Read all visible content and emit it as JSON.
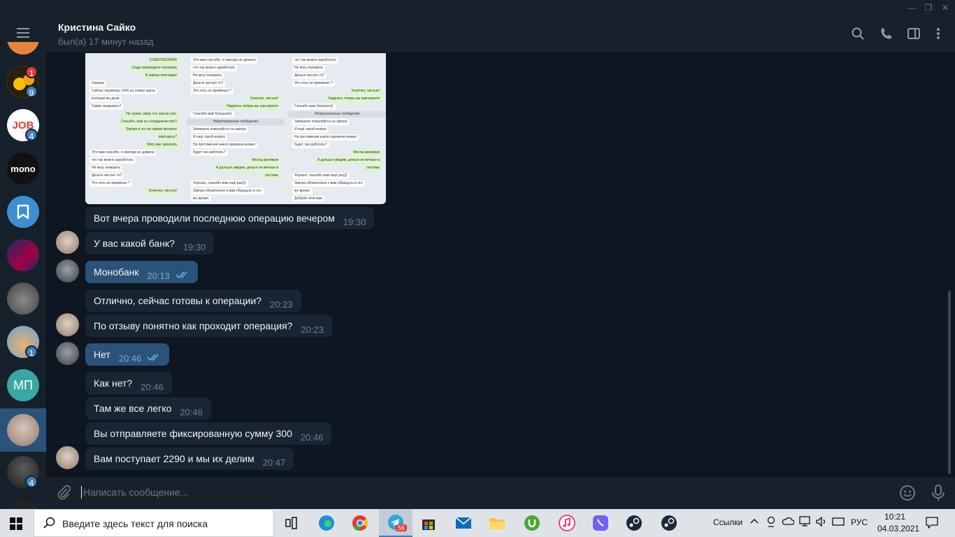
{
  "window": {
    "minimize": "—",
    "maximize": "❐",
    "close": "✕"
  },
  "sidebar": {
    "chats": [
      {
        "name": "chat-partial",
        "badge": ""
      },
      {
        "name": "chat-emoji",
        "badge": "9",
        "badge_top": "1"
      },
      {
        "name": "chat-job",
        "label": "JOB",
        "badge": "4"
      },
      {
        "name": "chat-mono",
        "label": "mono",
        "badge": ""
      },
      {
        "name": "chat-saved",
        "badge": ""
      },
      {
        "name": "chat-football",
        "badge": ""
      },
      {
        "name": "chat-cat",
        "badge": ""
      },
      {
        "name": "chat-cartoon",
        "badge": "1"
      },
      {
        "name": "chat-mp",
        "label": "МП",
        "badge": ""
      },
      {
        "name": "chat-kristina",
        "badge": ""
      },
      {
        "name": "chat-man",
        "badge": "4"
      }
    ]
  },
  "header": {
    "name": "Кристина Сайко",
    "status": "был(а) 17 минут назад"
  },
  "photo": {
    "col1": [
      "51689765234500",
      "Сюда переводите половину",
      "И завтра повторим!",
      "Хорошо",
      "Сейчас перевожу 1045 на номер карты",
      "который вы дали",
      "Скрин скидывать?",
      "Не нужно, вижу что зашли уже.",
      "Спасибо, вам за сотрудничество!!!",
      "Завтра в это же время желаете",
      "повторить?",
      "Могу вас записать",
      "Это вам спасибо, я никогда не думала",
      "что так можно заработать",
      "Не могу поверить",
      "Деньги чистые то?",
      "Это хоть не криминал ?",
      "Конечно, чистые!"
    ],
    "col2": [
      "Это вам спасибо, я никогда не думала",
      "что так можно заработать",
      "Не могу поверить",
      "Деньги чистые то?",
      "Это хоть не криминал ?",
      "Конечно, чистые!",
      "Надеюсь теперь вы нам верите",
      "Спасибо вам большое))",
      "Непрочитанные сообщения",
      "Запишите пожалуйста на завтра",
      "И ещё такой вопрос",
      "На протяжении какого времени можно",
      "будет так работать?",
      "Месяц минимум",
      "А дальше увидим, деньги не вечные в",
      "системе",
      "Хорошо, спасибо вам ещё раз)))",
      "Завтра обязательно к вам обращусь в это",
      "же время."
    ],
    "col3": [
      "что так можно заработать",
      "Не могу поверить",
      "Деньги чистые то?",
      "Это хоть не криминал ?",
      "Конечно, чистые!",
      "Надеюсь теперь вы нам верите",
      "Спасибо вам большое))",
      "Непрочитанные сообщения",
      "Запишите пожалуйста на завтра",
      "И ещё такой вопрос",
      "На протяжении какого времени можно",
      "будет так работать?",
      "Месяц минимум",
      "А дальше увидим, деньги не вечные в",
      "системе",
      "Хорошо, спасибо вам ещё раз)))",
      "Завтра обязательно к вам обращусь в это",
      "же время.",
      "Доброй ночи вам"
    ]
  },
  "messages": [
    {
      "text": "Вот вчера проводили последнюю операцию вечером",
      "time": "19:30",
      "dir": "in"
    },
    {
      "text": "У вас какой банк?",
      "time": "19:30",
      "dir": "in"
    },
    {
      "text": "Монобанк",
      "time": "20:13",
      "dir": "out"
    },
    {
      "text": "Отлично, сейчас готовы к операции?",
      "time": "20:23",
      "dir": "in"
    },
    {
      "text": "По отзыву понятно как проходит операция?",
      "time": "20:23",
      "dir": "in"
    },
    {
      "text": "Нет",
      "time": "20:46",
      "dir": "out"
    },
    {
      "text": "Как нет?",
      "time": "20:46",
      "dir": "in"
    },
    {
      "text": "Там же все легко",
      "time": "20:46",
      "dir": "in"
    },
    {
      "text": "Вы отправляете фиксированную сумму 300",
      "time": "20:46",
      "dir": "in"
    },
    {
      "text": "Вам поступает 2290 и мы их делим",
      "time": "20:47",
      "dir": "in"
    }
  ],
  "composer": {
    "placeholder": "Написать сообщение..."
  },
  "taskbar": {
    "search_placeholder": "Введите здесь текст для поиска",
    "telegram_badge": "56",
    "links_label": "Ссылки",
    "lang": "РУС",
    "time": "10:21",
    "date": "04.03.2021"
  },
  "colors": {
    "bg": "#0e1621",
    "panel": "#17212b",
    "incoming": "#182533",
    "outgoing": "#2b5278",
    "accent": "#4082bc"
  }
}
